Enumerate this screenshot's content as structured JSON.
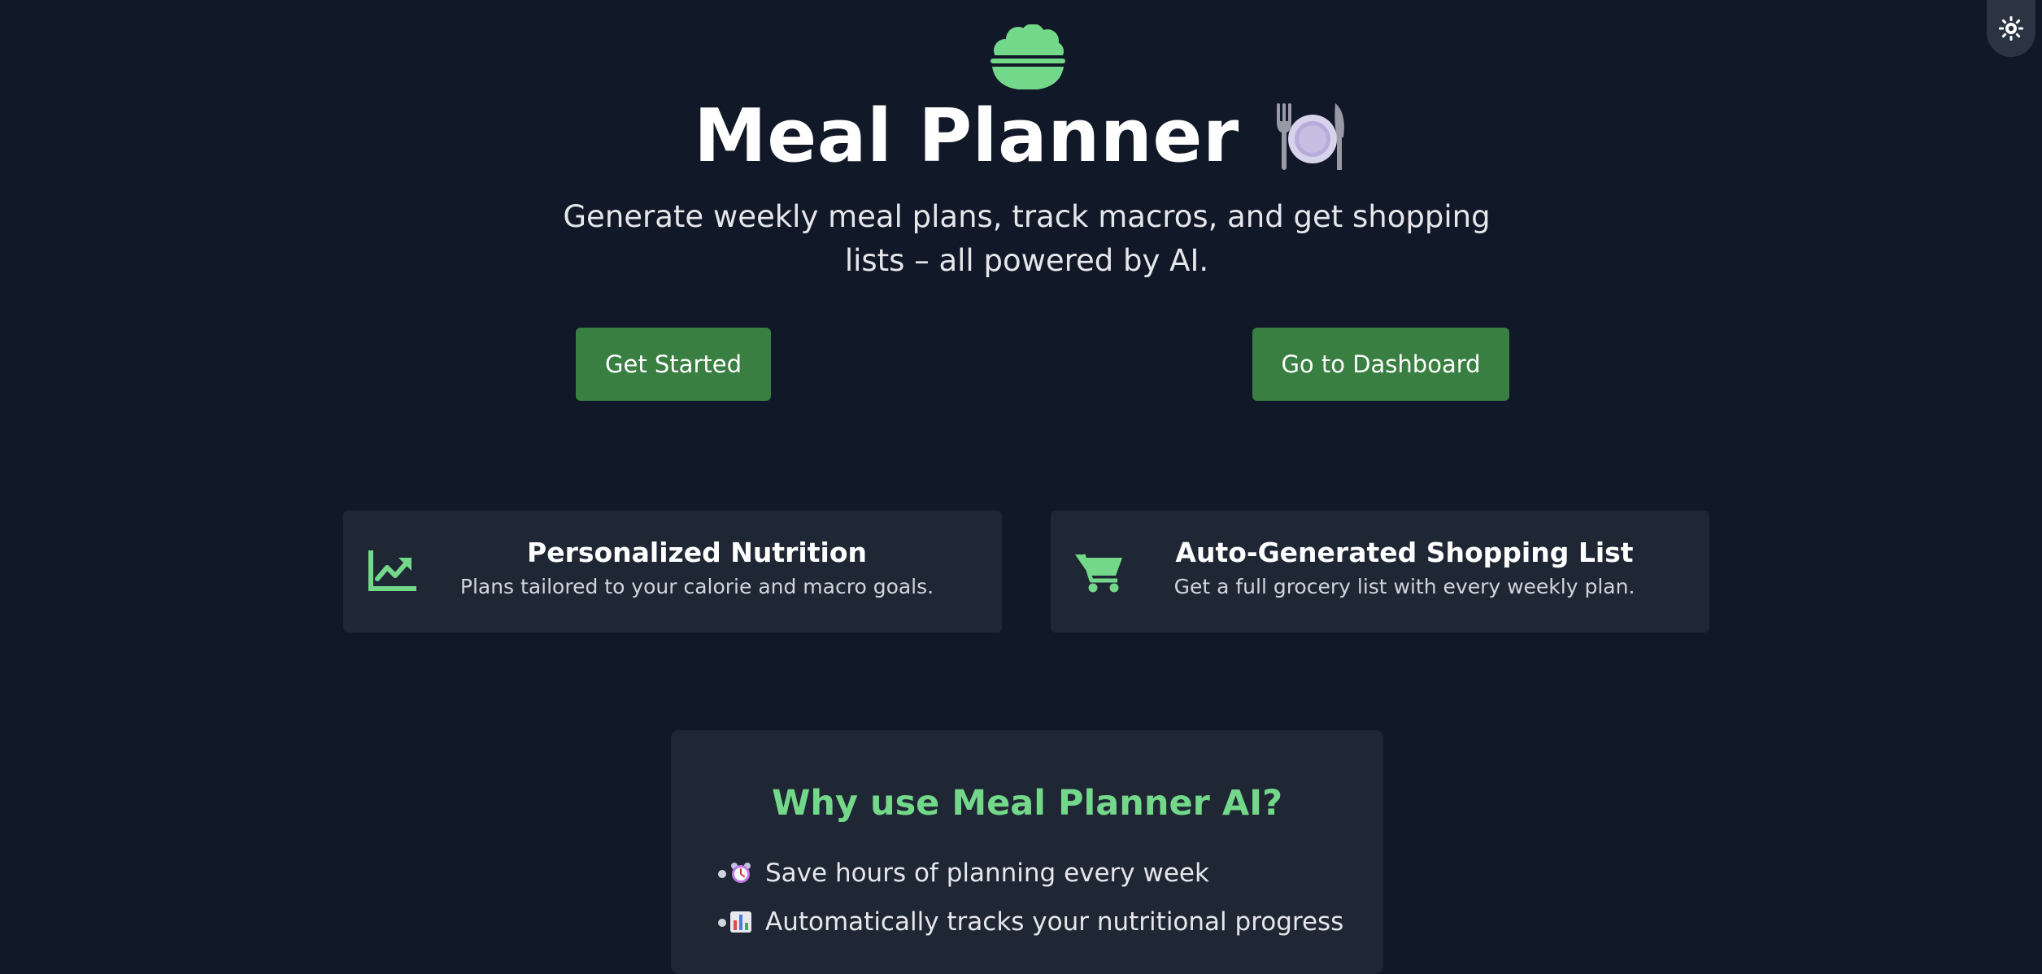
{
  "theme_toggle": {
    "icon": "sun-icon"
  },
  "hero": {
    "logo_icon": "bowl-icon",
    "title": "Meal Planner",
    "title_icon": "plate-with-cutlery-icon",
    "subtitle": "Generate weekly meal plans, track macros, and get shopping lists – all powered by AI."
  },
  "actions": {
    "get_started_label": "Get Started",
    "dashboard_label": "Go to Dashboard"
  },
  "features": [
    {
      "icon": "chart-line-icon",
      "title": "Personalized Nutrition",
      "description": "Plans tailored to your calorie and macro goals."
    },
    {
      "icon": "shopping-cart-icon",
      "title": "Auto-Generated Shopping List",
      "description": "Get a full grocery list with every weekly plan."
    }
  ],
  "why": {
    "title": "Why use Meal Planner AI?",
    "items": [
      {
        "icon": "alarm-clock-icon",
        "text": "Save hours of planning every week"
      },
      {
        "icon": "bar-chart-icon",
        "text": "Automatically tracks your nutritional progress"
      }
    ]
  },
  "colors": {
    "background": "#111827",
    "card": "#1f2735",
    "accent_green": "#74d88a",
    "button_green": "#3a7f42"
  }
}
